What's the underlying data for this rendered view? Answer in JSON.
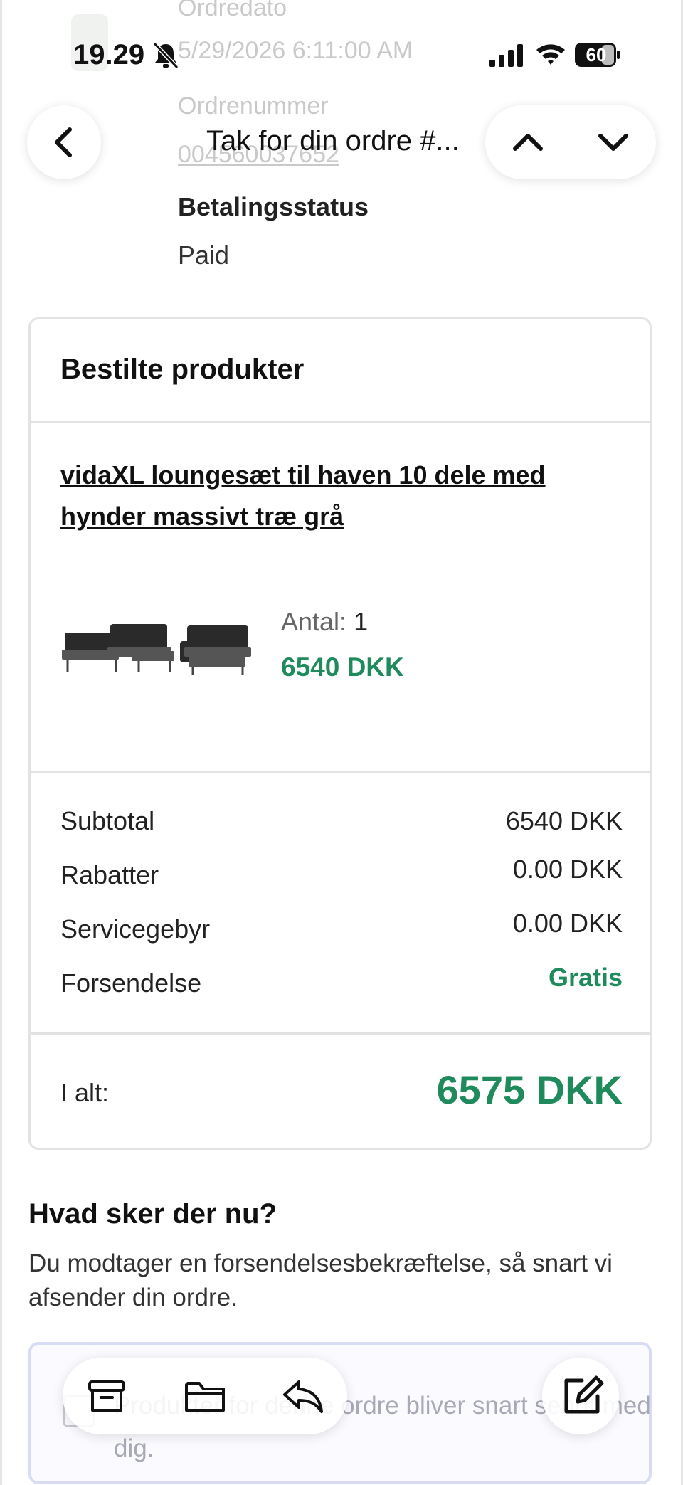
{
  "status_bar": {
    "time": "19.29",
    "battery": "60"
  },
  "background_header": {
    "order_date_label": "Ordredato",
    "order_date_value": "5/29/2026 6:11:00 AM",
    "order_number_label": "Ordrenummer",
    "order_number_value": "004560037652"
  },
  "nav": {
    "title": "Tak for din ordre #..."
  },
  "payment": {
    "label": "Betalingsstatus",
    "value": "Paid"
  },
  "order_card": {
    "title": "Bestilte produkter",
    "product": {
      "name": "vidaXL loungesæt til haven 10 dele med hynder massivt træ grå",
      "qty_label": "Antal:",
      "qty_value": "1",
      "price": "6540 DKK"
    },
    "summary": [
      {
        "label": "Subtotal",
        "value": "6540 DKK"
      },
      {
        "label": "Rabatter",
        "value": "0.00 DKK"
      },
      {
        "label": "Servicegebyr",
        "value": "0.00 DKK"
      },
      {
        "label": "Forsendelse",
        "value": "Gratis"
      }
    ],
    "total_label": "I alt:",
    "total_value": "6575 DKK"
  },
  "next": {
    "heading": "Hvad sker der nu?",
    "body": "Du modtager en forsendelsesbekræftelse, så snart vi afsender din ordre."
  },
  "notice": {
    "text": "Produkter for denne ordre bliver snart sendt med dig."
  },
  "colors": {
    "accent_green": "#1f8a5b",
    "border": "#e3e3e3"
  },
  "icons": {
    "back": "chevron-left-icon",
    "up": "chevron-up-icon",
    "down": "chevron-down-icon",
    "archive": "archive-icon",
    "folder": "folder-icon",
    "reply": "reply-icon",
    "compose": "compose-icon"
  }
}
